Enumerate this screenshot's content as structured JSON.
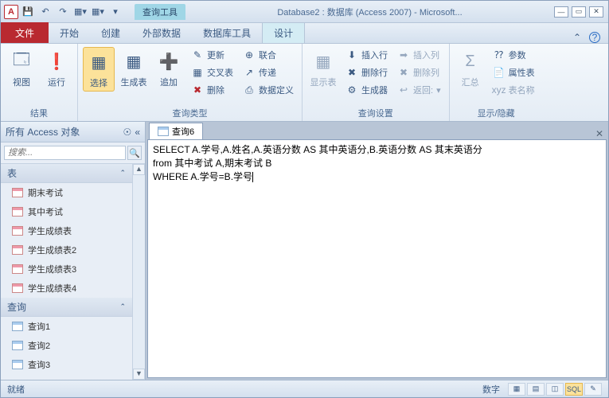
{
  "title": "Database2 : 数据库 (Access 2007)  -  Microsoft...",
  "ctx_tab": "查询工具",
  "tabs": {
    "file": "文件",
    "home": "开始",
    "create": "创建",
    "external": "外部数据",
    "dbtools": "数据库工具",
    "design": "设计"
  },
  "ribbon": {
    "groups": {
      "results": "结果",
      "querytype": "查询类型",
      "querysetup": "查询设置",
      "showhide": "显示/隐藏"
    },
    "buttons": {
      "view": "视图",
      "run": "运行",
      "select": "选择",
      "maketable": "生成表",
      "append": "追加",
      "update": "更新",
      "crosstab": "交叉表",
      "delete": "删除",
      "union": "联合",
      "passthrough": "传递",
      "datadef": "数据定义",
      "showtable": "显示表",
      "insertrows": "插入行",
      "deleterows": "删除行",
      "builder": "生成器",
      "insertcols": "插入列",
      "deletecols": "删除列",
      "return": "返回:",
      "totals": "汇总",
      "params": "参数",
      "propsheet": "属性表",
      "tablenames": "表名称"
    }
  },
  "nav": {
    "header": "所有 Access 对象",
    "search_ph": "搜索...",
    "sections": {
      "tables": "表",
      "queries": "查询"
    },
    "tables": [
      "期末考试",
      "其中考试",
      "学生成绩表",
      "学生成绩表2",
      "学生成绩表3",
      "学生成绩表4"
    ],
    "queries": [
      "查询1",
      "查询2",
      "查询3"
    ]
  },
  "doc": {
    "tab": "查询6",
    "sql_l1": "SELECT A.学号,A.姓名,A.英语分数 AS 其中英语分,B.英语分数 AS 其末英语分",
    "sql_l2": "from 其中考试 A,期末考试 B",
    "sql_l3": "WHERE A.学号=B.学号"
  },
  "status": {
    "ready": "就绪",
    "mode": "数字"
  }
}
